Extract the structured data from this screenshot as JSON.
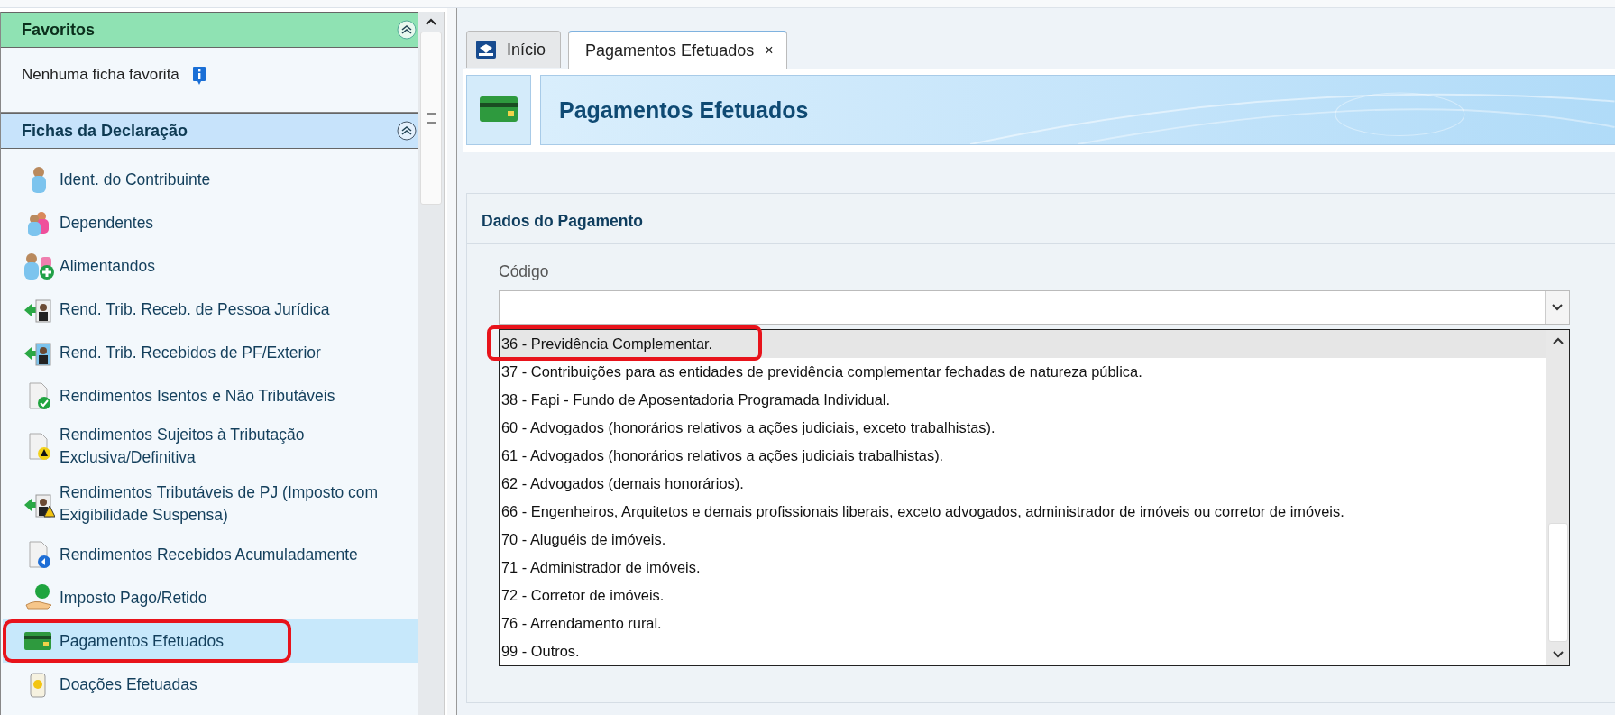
{
  "favorites": {
    "title": "Favoritos",
    "expanded": true,
    "empty_text": "Nenhuma ficha favorita"
  },
  "sheets": {
    "title": "Fichas da Declaração",
    "expanded": true,
    "items": [
      {
        "label": "Ident. do Contribuinte",
        "selected": false,
        "annotated": false
      },
      {
        "label": "Dependentes",
        "selected": false,
        "annotated": false
      },
      {
        "label": "Alimentandos",
        "selected": false,
        "annotated": false
      },
      {
        "label": "Rend. Trib. Receb. de Pessoa Jurídica",
        "selected": false,
        "annotated": false
      },
      {
        "label": "Rend. Trib. Recebidos de PF/Exterior",
        "selected": false,
        "annotated": false
      },
      {
        "label": "Rendimentos Isentos e Não Tributáveis",
        "selected": false,
        "annotated": false
      },
      {
        "label": "Rendimentos Sujeitos à Tributação Exclusiva/Definitiva",
        "selected": false,
        "annotated": false
      },
      {
        "label": "Rendimentos Tributáveis de PJ (Imposto com Exigibilidade Suspensa)",
        "selected": false,
        "annotated": false
      },
      {
        "label": "Rendimentos Recebidos Acumuladamente",
        "selected": false,
        "annotated": false
      },
      {
        "label": "Imposto Pago/Retido",
        "selected": false,
        "annotated": false
      },
      {
        "label": "Pagamentos Efetuados",
        "selected": true,
        "annotated": true
      },
      {
        "label": "Doações Efetuadas",
        "selected": false,
        "annotated": false
      }
    ]
  },
  "tabs": [
    {
      "label": "Início",
      "selected": false,
      "closable": false
    },
    {
      "label": "Pagamentos Efetuados",
      "selected": true,
      "closable": true,
      "close": "×"
    }
  ],
  "page_title": "Pagamentos Efetuados",
  "section": {
    "title": "Dados do Pagamento",
    "field": {
      "label": "Código",
      "expanded": true,
      "options": [
        {
          "label": "36 - Previdência Complementar.",
          "selected": true,
          "annotated": true
        },
        {
          "label": "37 - Contribuições para as entidades de previdência complementar fechadas de natureza pública.",
          "selected": false,
          "annotated": false
        },
        {
          "label": "38 - Fapi - Fundo de Aposentadoria Programada Individual.",
          "selected": false,
          "annotated": false
        },
        {
          "label": "60 - Advogados (honorários relativos a ações judiciais, exceto trabalhistas).",
          "selected": false,
          "annotated": false
        },
        {
          "label": "61 - Advogados (honorários relativos a ações judiciais trabalhistas).",
          "selected": false,
          "annotated": false
        },
        {
          "label": "62 - Advogados (demais honorários).",
          "selected": false,
          "annotated": false
        },
        {
          "label": "66 - Engenheiros, Arquitetos e demais profissionais liberais, exceto advogados, administrador de imóveis ou corretor de imóveis.",
          "selected": false,
          "annotated": false
        },
        {
          "label": "70 - Aluguéis de imóveis.",
          "selected": false,
          "annotated": false
        },
        {
          "label": "71 - Administrador de imóveis.",
          "selected": false,
          "annotated": false
        },
        {
          "label": "72 - Corretor de imóveis.",
          "selected": false,
          "annotated": false
        },
        {
          "label": "76 - Arrendamento rural.",
          "selected": false,
          "annotated": false
        },
        {
          "label": "99 - Outros.",
          "selected": false,
          "annotated": false
        }
      ]
    }
  }
}
